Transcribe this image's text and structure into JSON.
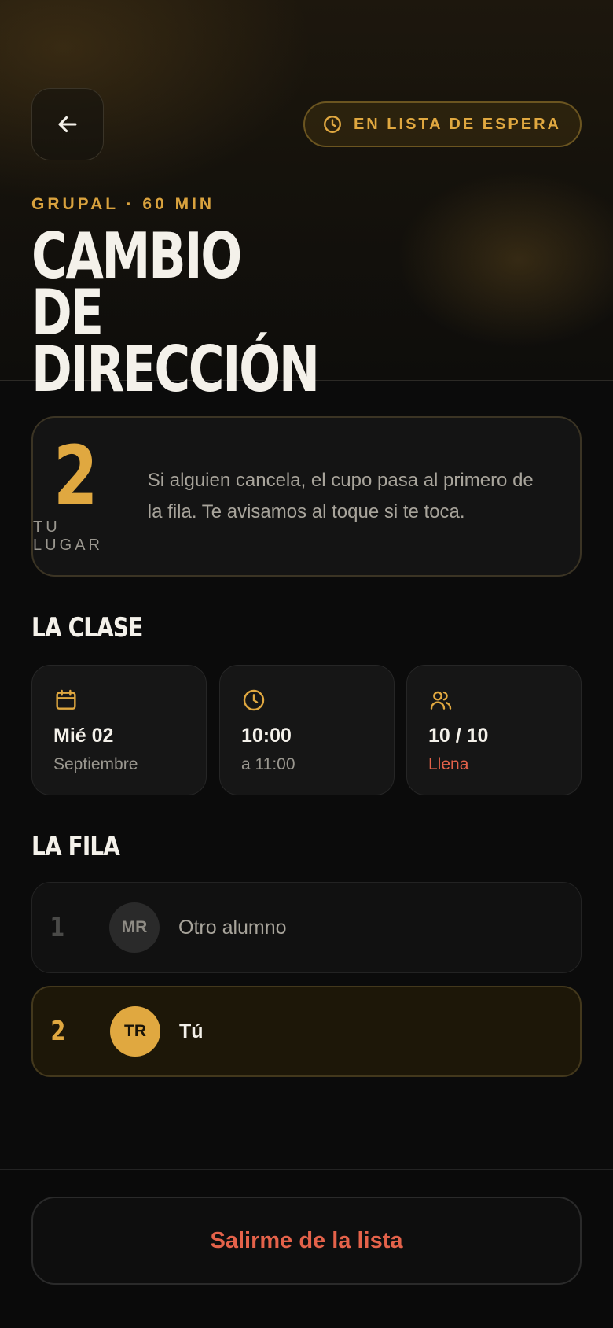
{
  "header": {
    "status_badge": "EN LISTA DE ESPERA",
    "eyebrow": "GRUPAL · 60 MIN",
    "title_line1": "Cambio de",
    "title_line2": "Dirección"
  },
  "spot": {
    "number": "2",
    "label": "TU LUGAR",
    "message": "Si alguien cancela, el cupo pasa al primero de la fila. Te avisamos al toque si te toca."
  },
  "class_section": {
    "heading": "La clase",
    "cards": [
      {
        "icon": "calendar-icon",
        "main": "Mié 02",
        "sub": "Septiembre"
      },
      {
        "icon": "clock-icon",
        "main": "10:00",
        "sub": "a 11:00"
      },
      {
        "icon": "users-icon",
        "main": "10 / 10",
        "sub": "Llena"
      }
    ]
  },
  "queue_section": {
    "heading": "La fila",
    "rows": [
      {
        "position": "1",
        "initials": "MR",
        "name": "Otro alumno"
      },
      {
        "position": "2",
        "initials": "TR",
        "name": "Tú"
      }
    ]
  },
  "footer": {
    "leave_label": "Salirme de la lista"
  },
  "colors": {
    "accent": "#e0a840",
    "danger": "#e4624a",
    "background": "#0b0b0b"
  }
}
